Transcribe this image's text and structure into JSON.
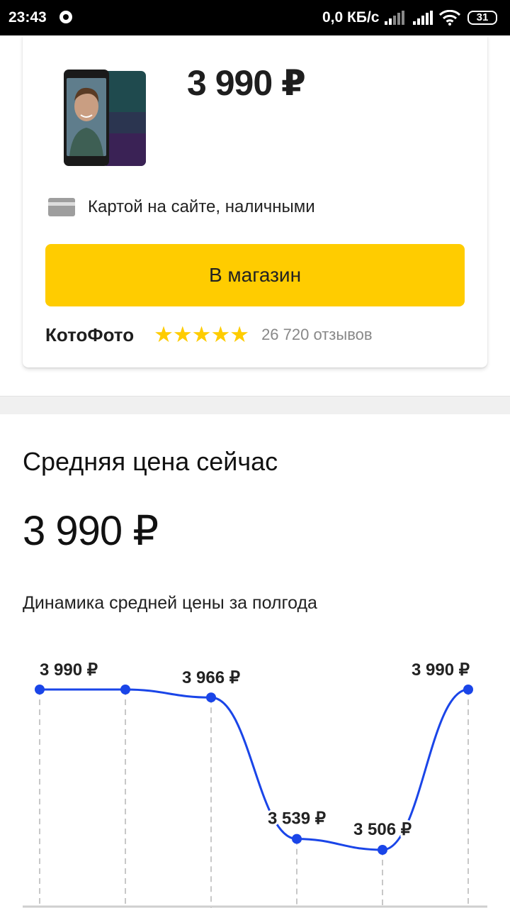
{
  "status_bar": {
    "time": "23:43",
    "network_speed": "0,0 КБ/с",
    "battery": "31"
  },
  "offer": {
    "price": "3 990 ₽",
    "payment_methods": "Картой на сайте, наличными",
    "button_label": "В магазин",
    "shop_name": "КотоФото",
    "rating_stars": 5,
    "reviews": "26 720 отзывов",
    "colors": {
      "button": "#ffcc00",
      "stars": "#fecc00"
    }
  },
  "average": {
    "title": "Средняя цена сейчас",
    "price": "3 990 ₽",
    "chart_caption": "Динамика средней цены за полгода"
  },
  "chart_data": {
    "type": "line",
    "title": "",
    "xlabel": "",
    "ylabel": "",
    "x": [
      "",
      "",
      "",
      "",
      "",
      ""
    ],
    "series": [
      {
        "values": [
          3990,
          3990,
          3966,
          3539,
          3506,
          3990
        ],
        "labels": [
          "3 990 ₽",
          "",
          "3 966 ₽",
          "3 539 ₽",
          "3 506 ₽",
          "3 990 ₽"
        ]
      }
    ],
    "ylim": [
      3506,
      3990
    ],
    "grid": "vertical dashed",
    "line_color": "#1a45e8"
  }
}
